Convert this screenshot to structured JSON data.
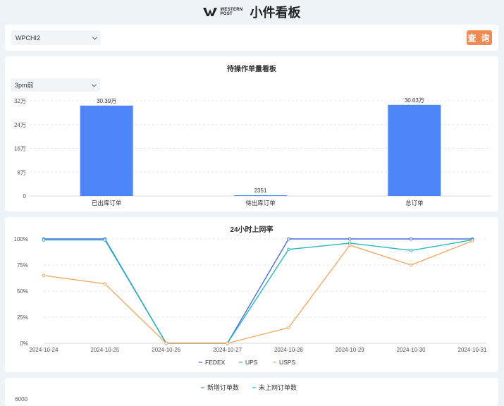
{
  "header": {
    "logo_line1": "WESTERN",
    "logo_line2": "POST",
    "title": "小件看板"
  },
  "filter": {
    "warehouse_value": "WPCHI2",
    "query_label": "查 询"
  },
  "pending_panel": {
    "title": "待操作单量看板",
    "time_select": "3pm前"
  },
  "rate_panel": {
    "title": "24小时上网率"
  },
  "orders_panel": {
    "legend": [
      "新增订单数",
      "未上网订单数"
    ],
    "y_top_tick": "6000"
  },
  "colors": {
    "accent": "#ef8a55",
    "bar": "#4e86f7",
    "fedex": "#4a6fe0",
    "ups": "#26b7bf",
    "usps": "#f3aa65"
  },
  "chart_data": [
    {
      "type": "bar",
      "title": "待操作单量看板",
      "categories": [
        "已出库订单",
        "待出库订单",
        "总订单"
      ],
      "values": [
        303900,
        2351,
        306300
      ],
      "data_labels": [
        "30.39万",
        "2351",
        "30.63万"
      ],
      "y_ticks": [
        "0",
        "8万",
        "16万",
        "24万",
        "32万"
      ],
      "y_tick_values": [
        0,
        80000,
        160000,
        240000,
        320000
      ],
      "ylim": [
        0,
        320000
      ],
      "grid": true
    },
    {
      "type": "line",
      "title": "24小时上网率",
      "x": [
        "2024-10-24",
        "2024-10-25",
        "2024-10-26",
        "2024-10-27",
        "2024-10-28",
        "2024-10-29",
        "2024-10-30",
        "2024-10-31"
      ],
      "y_ticks": [
        "0%",
        "25%",
        "50%",
        "75%",
        "100%"
      ],
      "y_tick_values": [
        0,
        25,
        50,
        75,
        100
      ],
      "ylim": [
        0,
        100
      ],
      "grid": true,
      "legend_position": "bottom",
      "series": [
        {
          "name": "FEDEX",
          "values": [
            100,
            100,
            0,
            0,
            100,
            100,
            100,
            100
          ]
        },
        {
          "name": "UPS",
          "values": [
            99,
            99,
            0,
            0,
            90,
            96,
            89,
            99
          ]
        },
        {
          "name": "USPS",
          "values": [
            65,
            57,
            0,
            0,
            15,
            94,
            75,
            98
          ]
        }
      ]
    }
  ]
}
